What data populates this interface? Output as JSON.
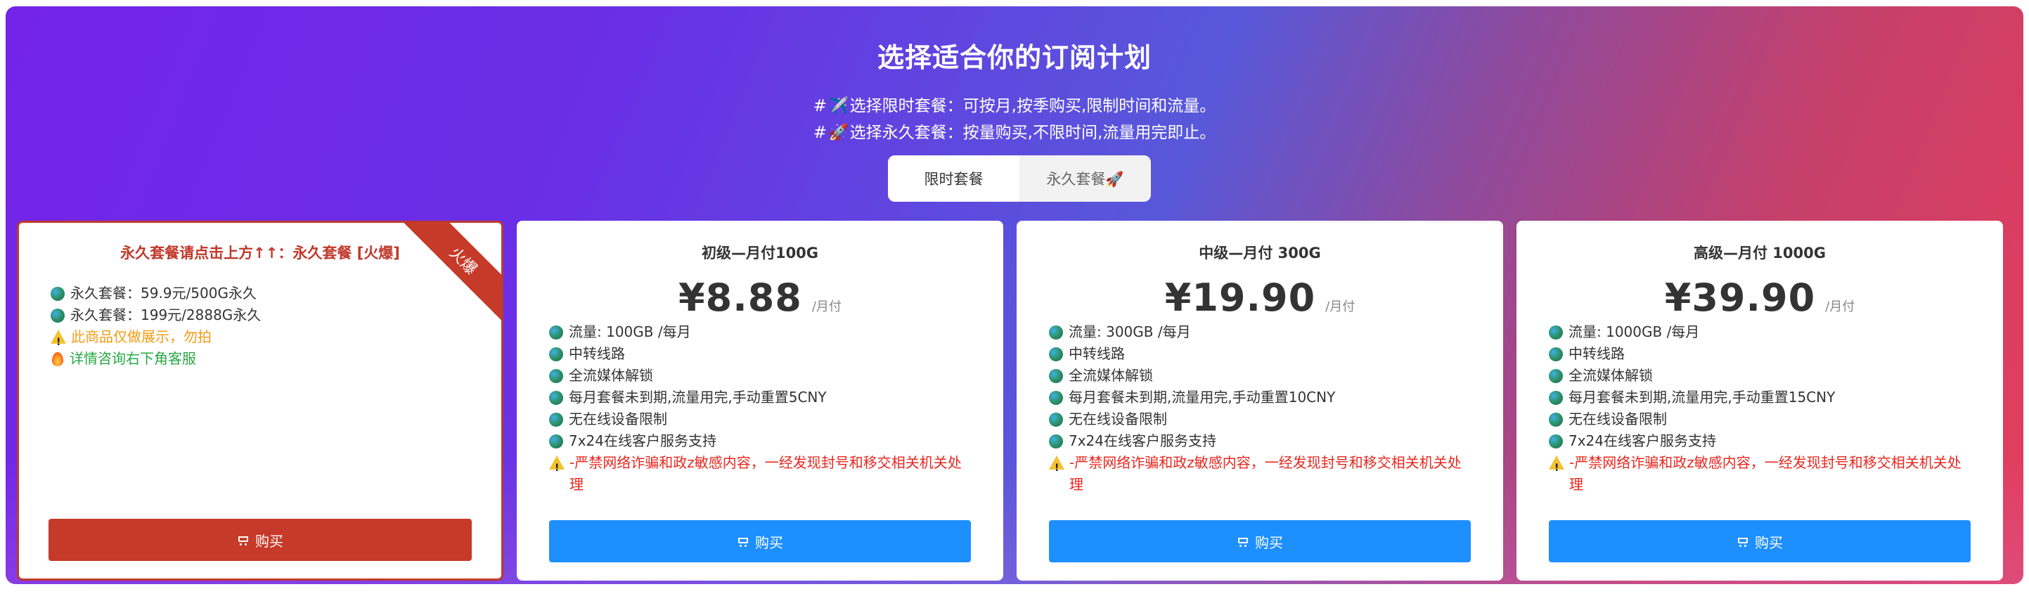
{
  "header": {
    "title": "选择适合你的订阅计划",
    "line1_prefix": "#",
    "line1_icon": "✈️",
    "line1_text": "选择限时套餐：可按月,按季购买,限制时间和流量。",
    "line2_prefix": "#",
    "line2_icon": "🚀",
    "line2_text": "选择永久套餐：按量购买,不限时间,流量用完即止。"
  },
  "tabs": [
    {
      "label": "限时套餐",
      "active": true
    },
    {
      "label": "永久套餐🚀",
      "active": false
    }
  ],
  "cards": [
    {
      "title": "永久套餐请点击上方↑↑：永久套餐 [火爆]",
      "ribbon": "火爆",
      "features": [
        {
          "icon": "globe-icon",
          "text": "永久套餐：59.9元/500G永久"
        },
        {
          "icon": "globe-icon",
          "text": "永久套餐：199元/2888G永久"
        },
        {
          "icon": "warning-icon",
          "text": "此商品仅做展示，勿拍"
        },
        {
          "icon": "fire-icon",
          "text": "详情咨询右下角客服"
        }
      ],
      "buy_label": "购买"
    },
    {
      "title": "初级—月付100G",
      "price": "¥8.88",
      "unit": "/月付",
      "features": [
        "流量: 100GB /每月",
        "中转线路",
        "全流媒体解锁",
        "每月套餐未到期,流量用完,手动重置5CNY",
        "无在线设备限制",
        "7x24在线客户服务支持"
      ],
      "warning": "-严禁网络诈骗和政z敏感内容，一经发现封号和移交相关机关处理",
      "buy_label": "购买"
    },
    {
      "title": "中级—月付 300G",
      "price": "¥19.90",
      "unit": "/月付",
      "features": [
        "流量: 300GB /每月",
        "中转线路",
        "全流媒体解锁",
        "每月套餐未到期,流量用完,手动重置10CNY",
        "无在线设备限制",
        "7x24在线客户服务支持"
      ],
      "warning": "-严禁网络诈骗和政z敏感内容，一经发现封号和移交相关机关处理",
      "buy_label": "购买"
    },
    {
      "title": "高级—月付 1000G",
      "price": "¥39.90",
      "unit": "/月付",
      "features": [
        "流量: 1000GB /每月",
        "中转线路",
        "全流媒体解锁",
        "每月套餐未到期,流量用完,手动重置15CNY",
        "无在线设备限制",
        "7x24在线客户服务支持"
      ],
      "warning": "-严禁网络诈骗和政z敏感内容，一经发现封号和移交相关机关处理",
      "buy_label": "购买"
    }
  ],
  "colors": {
    "accent_blue": "#1e8fff",
    "accent_red": "#c63a2a",
    "warning_red": "#e8271f",
    "notice_orange": "#f39c12",
    "notice_green": "#27a844"
  }
}
